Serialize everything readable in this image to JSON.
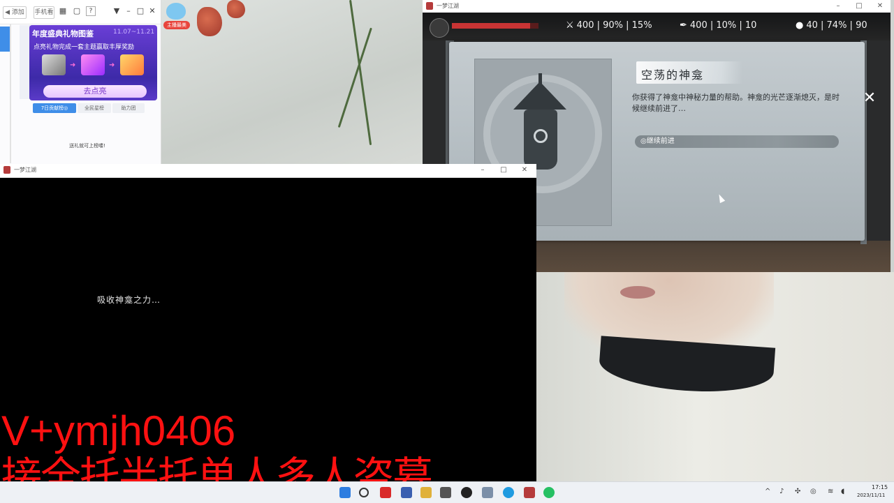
{
  "left_panel": {
    "toolbar": {
      "add_label": "◀ 添加",
      "mobile_label": "手机看",
      "help_label": "?"
    },
    "anchor_tag": "主播最美",
    "gift_card": {
      "title": "年度盛典礼物图鉴",
      "date": "11.07~11.21",
      "subtitle": "点亮礼物完成一套主题赢取丰厚奖励",
      "button": "去点亮"
    },
    "rank_tabs": [
      "7日贡献榜◎",
      "全民星榜",
      "助力团"
    ],
    "rank_note": "送礼就可上榜喽!"
  },
  "game_top": {
    "window_title": "一梦江湖",
    "hp_percent": 0.9,
    "stats": [
      {
        "icon": "spear-icon",
        "glyph": "⚔",
        "text": "400 | 90% | 15%"
      },
      {
        "icon": "feather-icon",
        "glyph": "✒",
        "text": "400 | 10% | 10"
      },
      {
        "icon": "flask-icon",
        "glyph": "●",
        "text": "40 | 74% | 90"
      }
    ],
    "event": {
      "title": "空荡的神龛",
      "description": "你获得了神龛中神秘力量的帮助。神龛的光芒逐渐熄灭，是时候继续前进了…",
      "choice": "◎继续前进",
      "close": "✕"
    }
  },
  "game_bottom": {
    "window_title": "一梦江湖",
    "message": "吸收神龛之力…"
  },
  "overlay": {
    "line1": "V+ymjh0406",
    "line2": "接全托半托单人多人盗墓"
  },
  "taskbar": {
    "time": "17:15",
    "date": "2023/11/11"
  },
  "colors": {
    "overlay_red": "#ff1111",
    "hp_red": "#c83434",
    "gift_purple": "#5b3bc8"
  }
}
